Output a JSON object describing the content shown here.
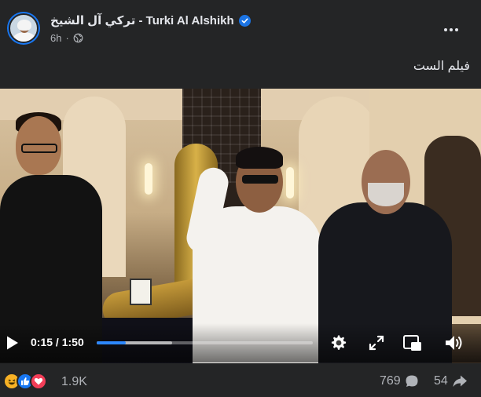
{
  "post": {
    "author": "تركي آل الشيخ - Turki Al Alshikh",
    "time": "6h",
    "caption": "فيلم الست"
  },
  "video": {
    "current_time": "0:15",
    "separator": "/",
    "duration": "1:50",
    "progress_fraction": 0.136,
    "buffered_fraction": 0.35
  },
  "footer": {
    "reaction_count": "1.9K",
    "comment_count": "769",
    "share_count": "54",
    "reactions": [
      "haha",
      "like",
      "love"
    ]
  },
  "colors": {
    "accent": "#2d88ff",
    "verified": "#1b74e4",
    "background": "#242526",
    "secondary_text": "#b0b3b8"
  },
  "icons": [
    "verified-badge-icon",
    "globe-icon",
    "more-icon",
    "play-icon",
    "settings-icon",
    "fullscreen-icon",
    "miniplayer-icon",
    "volume-icon",
    "comment-icon",
    "share-icon"
  ]
}
